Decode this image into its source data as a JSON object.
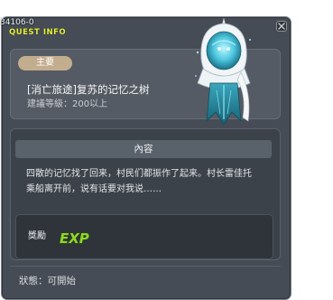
{
  "window": {
    "id_text": "34106-0",
    "title": "QUEST INFO"
  },
  "quest": {
    "category_badge": "主要",
    "name": "[消亡旅途]复苏的记忆之树",
    "recommended_level": "建議等級：200以上"
  },
  "content": {
    "header": "內容",
    "description": "四散的记忆找了回来，村民们都振作了起来。村长雷佳托乘船离开前，说有话要对我说……"
  },
  "reward": {
    "label": "獎勵",
    "icon_text": "EXP"
  },
  "status": {
    "text": "狀態：可開始"
  },
  "colors": {
    "window_bg": "#464c55",
    "title_yellow": "#e8f23c",
    "badge_tan": "#c3ad8f",
    "exp_green": "#8fd62a"
  },
  "icons": {
    "close": "close-icon",
    "npc": "npc-portrait",
    "exp": "exp-icon"
  }
}
